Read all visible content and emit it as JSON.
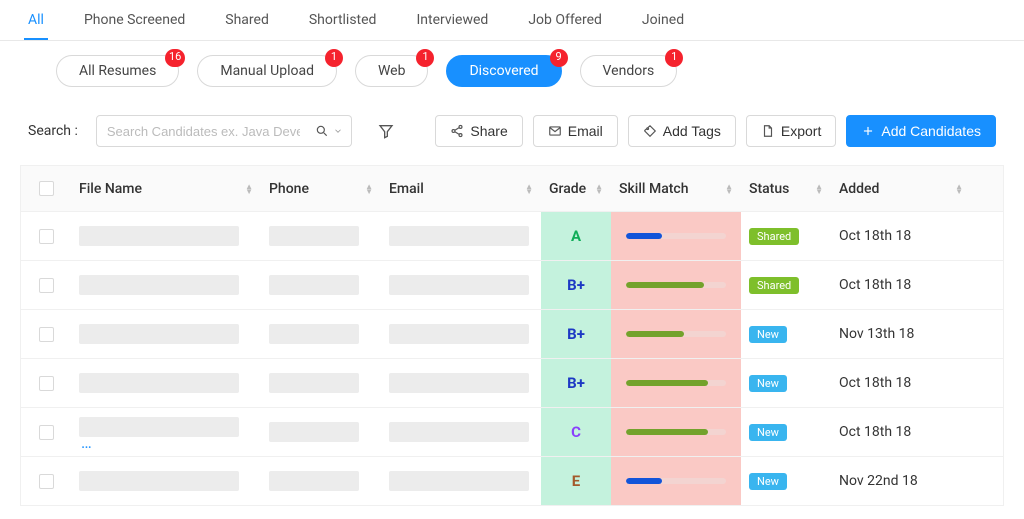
{
  "stage_tabs": [
    "All",
    "Phone Screened",
    "Shared",
    "Shortlisted",
    "Interviewed",
    "Job Offered",
    "Joined"
  ],
  "stage_active_index": 0,
  "sources": [
    {
      "label": "All Resumes",
      "count": 16,
      "active": false
    },
    {
      "label": "Manual Upload",
      "count": 1,
      "active": false
    },
    {
      "label": "Web",
      "count": 1,
      "active": false
    },
    {
      "label": "Discovered",
      "count": 9,
      "active": true
    },
    {
      "label": "Vendors",
      "count": 1,
      "active": false
    }
  ],
  "search_label": "Search :",
  "search_placeholder": "Search Candidates ex. Java Develop",
  "actions": {
    "share": "Share",
    "email": "Email",
    "add_tags": "Add Tags",
    "export": "Export",
    "add_candidates": "Add Candidates"
  },
  "columns": [
    "File Name",
    "Phone",
    "Email",
    "Grade",
    "Skill Match",
    "Status",
    "Added"
  ],
  "rows": [
    {
      "grade": "A",
      "grade_class": "grade-a",
      "skill_pct": 36,
      "skill_color": "sf-blue",
      "status": "Shared",
      "status_class": "st-shared",
      "added": "Oct 18th 18",
      "show_ellipsis": false
    },
    {
      "grade": "B+",
      "grade_class": "grade-bp",
      "skill_pct": 78,
      "skill_color": "sf-green",
      "status": "Shared",
      "status_class": "st-shared",
      "added": "Oct 18th 18",
      "show_ellipsis": false
    },
    {
      "grade": "B+",
      "grade_class": "grade-bp",
      "skill_pct": 58,
      "skill_color": "sf-green",
      "status": "New",
      "status_class": "st-new",
      "added": "Nov 13th 18",
      "show_ellipsis": false
    },
    {
      "grade": "B+",
      "grade_class": "grade-bp",
      "skill_pct": 82,
      "skill_color": "sf-green",
      "status": "New",
      "status_class": "st-new",
      "added": "Oct 18th 18",
      "show_ellipsis": false
    },
    {
      "grade": "C",
      "grade_class": "grade-c",
      "skill_pct": 82,
      "skill_color": "sf-green",
      "status": "New",
      "status_class": "st-new",
      "added": "Oct 18th 18",
      "show_ellipsis": true
    },
    {
      "grade": "E",
      "grade_class": "grade-e",
      "skill_pct": 36,
      "skill_color": "sf-blue",
      "status": "New",
      "status_class": "st-new",
      "added": "Nov 22nd 18",
      "show_ellipsis": false
    }
  ]
}
